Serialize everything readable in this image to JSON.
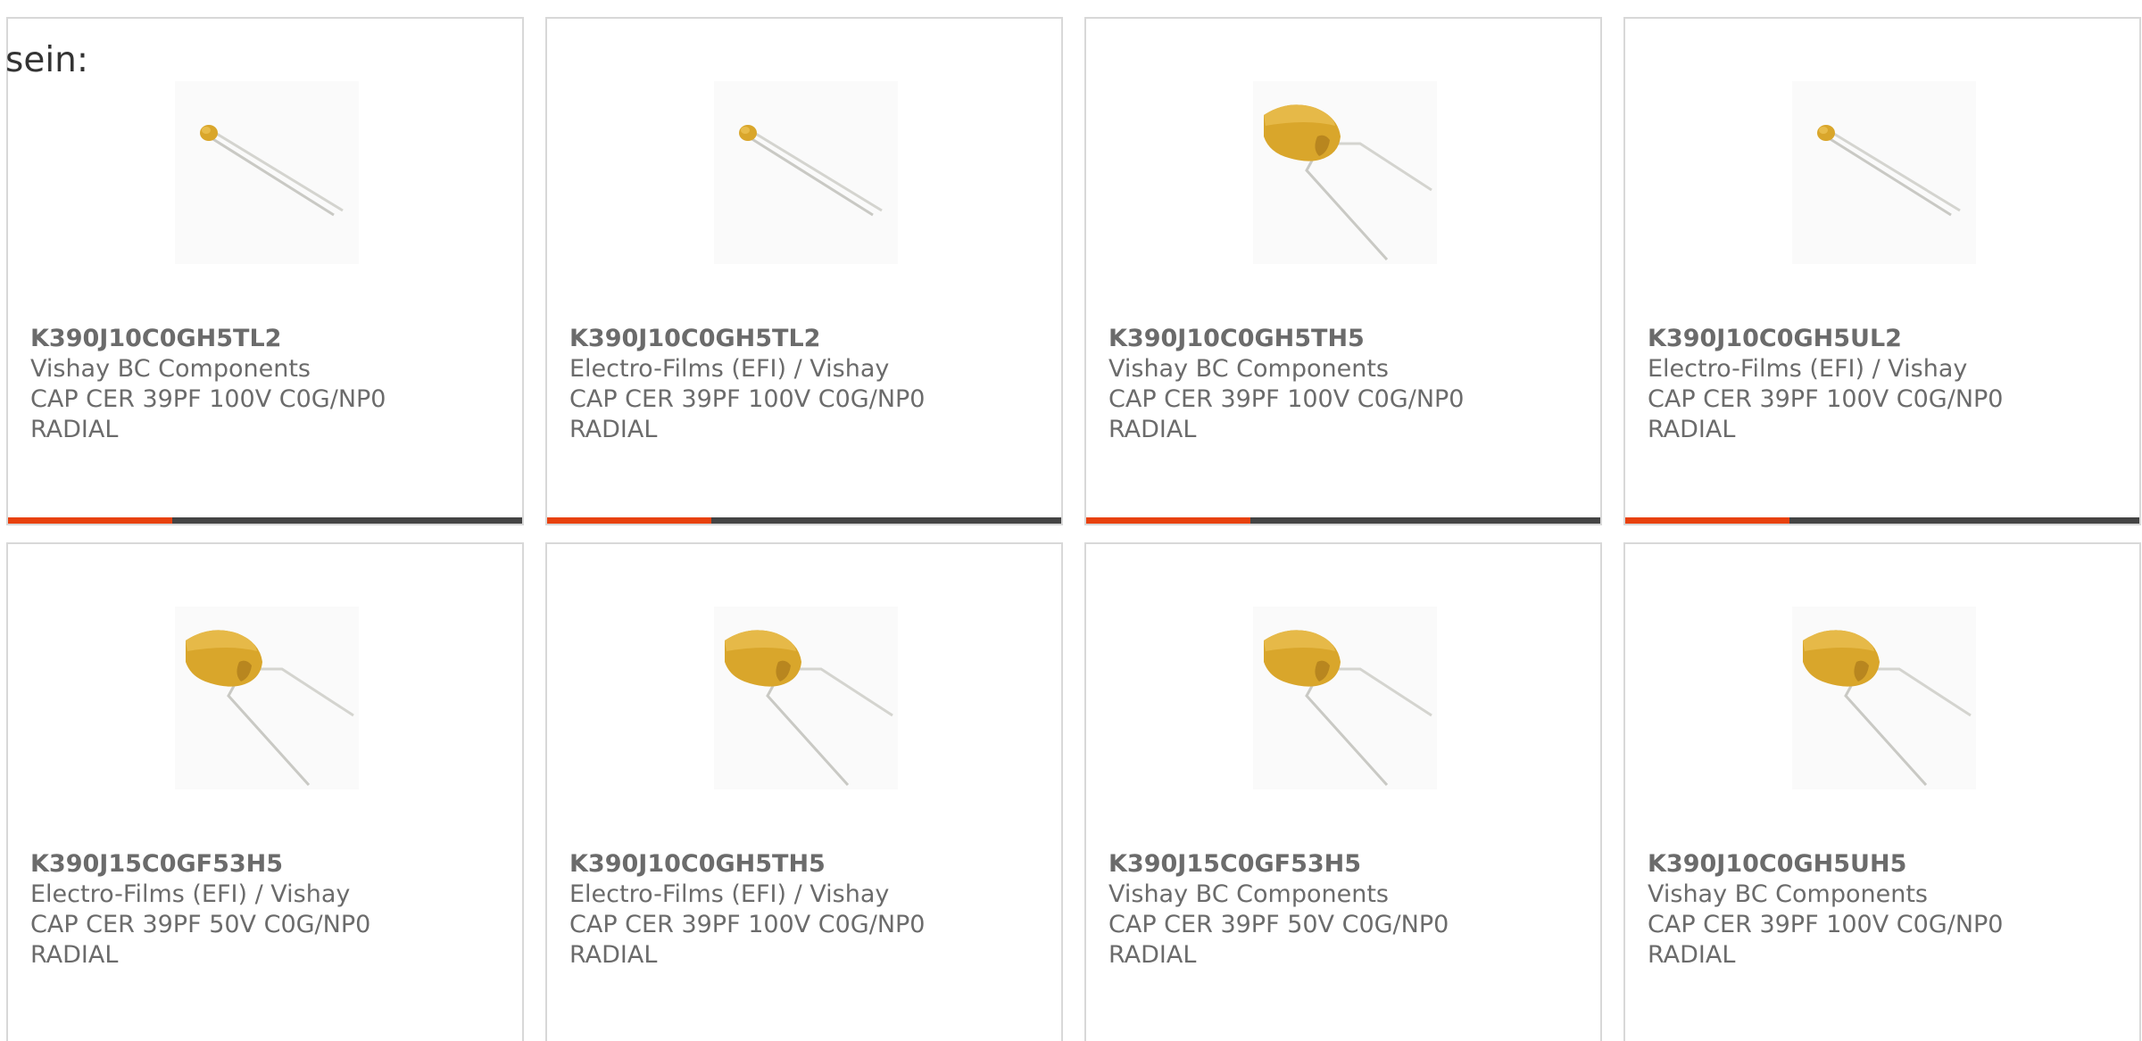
{
  "intro": {
    "text": "sein:"
  },
  "colors": {
    "accent": "#e8410d",
    "bar": "#444444",
    "border": "#d8d8d8",
    "text": "#6b6b6b",
    "capacitor_body": "#d9a62b"
  },
  "cards": [
    {
      "part_number": "K390J10C0GH5TL2",
      "manufacturer": "Vishay BC Components",
      "description": "CAP CER 39PF 100V C0G/NP0",
      "package": "RADIAL",
      "image_icon": "small-radial-capacitor-icon"
    },
    {
      "part_number": "K390J10C0GH5TL2",
      "manufacturer": "Electro-Films (EFI) / Vishay",
      "description": "CAP CER 39PF 100V C0G/NP0",
      "package": "RADIAL",
      "image_icon": "small-radial-capacitor-icon"
    },
    {
      "part_number": "K390J10C0GH5TH5",
      "manufacturer": "Vishay BC Components",
      "description": "CAP CER 39PF 100V C0G/NP0",
      "package": "RADIAL",
      "image_icon": "large-radial-capacitor-icon"
    },
    {
      "part_number": "K390J10C0GH5UL2",
      "manufacturer": "Electro-Films (EFI) / Vishay",
      "description": "CAP CER 39PF 100V C0G/NP0",
      "package": "RADIAL",
      "image_icon": "small-radial-capacitor-icon"
    },
    {
      "part_number": "K390J15C0GF53H5",
      "manufacturer": "Electro-Films (EFI) / Vishay",
      "description": "CAP CER 39PF 50V C0G/NP0",
      "package": "RADIAL",
      "image_icon": "large-radial-capacitor-icon"
    },
    {
      "part_number": "K390J10C0GH5TH5",
      "manufacturer": "Electro-Films (EFI) / Vishay",
      "description": "CAP CER 39PF 100V C0G/NP0",
      "package": "RADIAL",
      "image_icon": "large-radial-capacitor-icon"
    },
    {
      "part_number": "K390J15C0GF53H5",
      "manufacturer": "Vishay BC Components",
      "description": "CAP CER 39PF 50V C0G/NP0",
      "package": "RADIAL",
      "image_icon": "large-radial-capacitor-icon"
    },
    {
      "part_number": "K390J10C0GH5UH5",
      "manufacturer": "Vishay BC Components",
      "description": "CAP CER 39PF 100V C0G/NP0",
      "package": "RADIAL",
      "image_icon": "large-radial-capacitor-icon"
    }
  ]
}
